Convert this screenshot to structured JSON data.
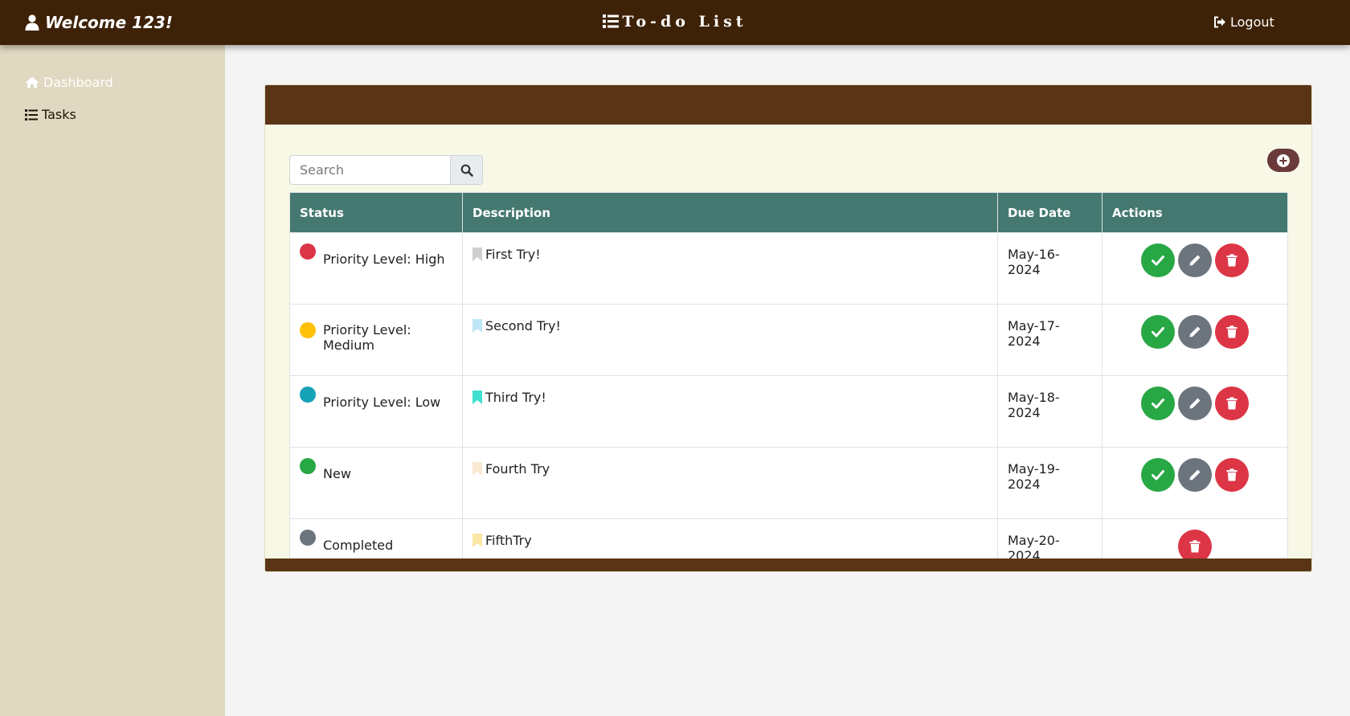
{
  "header": {
    "welcome": "Welcome 123!",
    "title": "To-do List",
    "logout": "Logout"
  },
  "sidebar": {
    "items": [
      {
        "label": "Dashboard",
        "icon": "home-icon"
      },
      {
        "label": "Tasks",
        "icon": "list-icon"
      }
    ]
  },
  "search": {
    "placeholder": "Search",
    "value": ""
  },
  "table": {
    "columns": [
      "Status",
      "Description",
      "Due Date",
      "Actions"
    ],
    "rows": [
      {
        "status": "Priority Level: High",
        "status_color": "#dc3545",
        "description": "First Try!",
        "flag_color": "#cfcfcf",
        "due": "May-16-2024",
        "actions": [
          "complete",
          "edit",
          "delete"
        ]
      },
      {
        "status": "Priority Level: Medium",
        "status_color": "#ffc107",
        "description": "Second Try!",
        "flag_color": "#bde7f5",
        "due": "May-17-2024",
        "actions": [
          "complete",
          "edit",
          "delete"
        ]
      },
      {
        "status": "Priority Level: Low",
        "status_color": "#17a2b8",
        "description": "Third Try!",
        "flag_color": "#40e0d0",
        "due": "May-18-2024",
        "actions": [
          "complete",
          "edit",
          "delete"
        ]
      },
      {
        "status": "New",
        "status_color": "#28a745",
        "description": "Fourth Try",
        "flag_color": "#fbe9d2",
        "due": "May-19-2024",
        "actions": [
          "complete",
          "edit",
          "delete"
        ]
      },
      {
        "status": "Completed",
        "status_color": "#6c757d",
        "description": "FifthTry",
        "flag_color": "#fbe6a5",
        "due": "May-20-2024",
        "actions": [
          "delete"
        ]
      }
    ]
  },
  "colors": {
    "topbar": "#3d2208",
    "sidebar": "#e0d8c0",
    "card_header": "#5a3515",
    "card_body": "#f8f8e6",
    "table_header": "#447870",
    "add_button": "#6b3a3a"
  }
}
